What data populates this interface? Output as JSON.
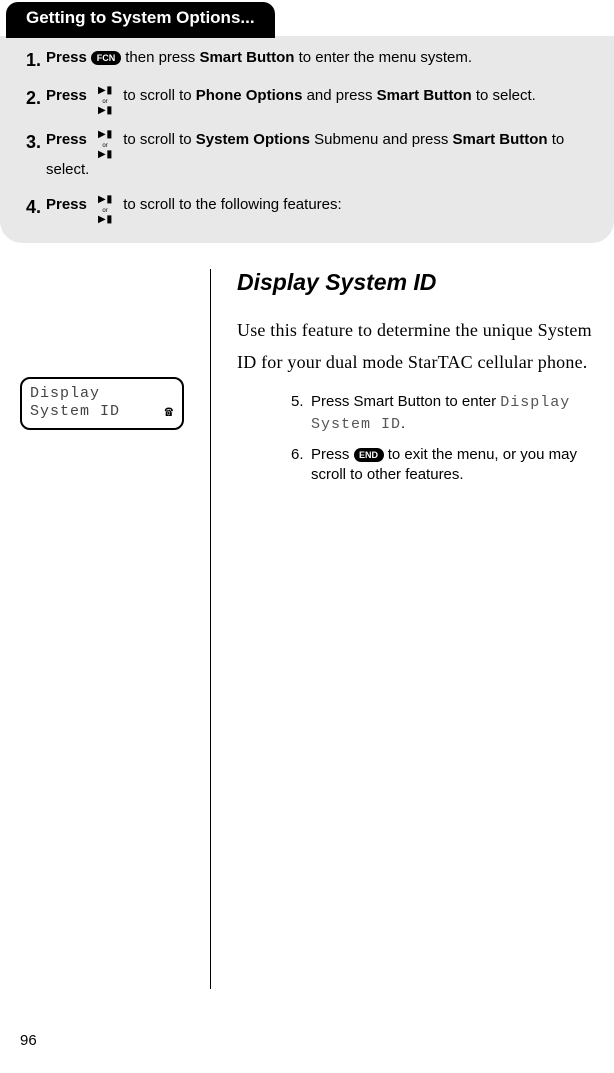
{
  "tab_title": "Getting to System Options...",
  "steps": [
    {
      "num": "1.",
      "press": "Press",
      "key": "FCN",
      "text_a": " then press ",
      "bold_a": "Smart Button",
      "text_b": " to enter the menu system."
    },
    {
      "num": "2.",
      "press": "Press",
      "text_a": "to scroll to ",
      "bold_a": "Phone Options",
      "text_b": " and press ",
      "bold_b": "Smart Button",
      "text_c": " to select."
    },
    {
      "num": "3.",
      "press": "Press",
      "text_a": "to scroll to ",
      "bold_a": "System Options",
      "text_b": " Submenu and press ",
      "bold_b": "Smart Button",
      "text_c": " to select."
    },
    {
      "num": "4.",
      "press": "Press",
      "text_a": "to scroll to the following features:"
    }
  ],
  "scroll_or": "or",
  "section_title": "Display System ID",
  "intro": "Use this feature to determine the unique System ID for your dual mode StarTAC cellular phone.",
  "lcd": {
    "line1": "Display",
    "line2": "System ID"
  },
  "sub5": {
    "n": "5.",
    "a": "Press Smart Button to enter ",
    "code1": "Display",
    "code2": "System ID",
    "dot": "."
  },
  "sub6": {
    "n": "6.",
    "a": "Press ",
    "key": "END",
    "b": " to exit the menu, or you may scroll to other features."
  },
  "page_number": "96"
}
